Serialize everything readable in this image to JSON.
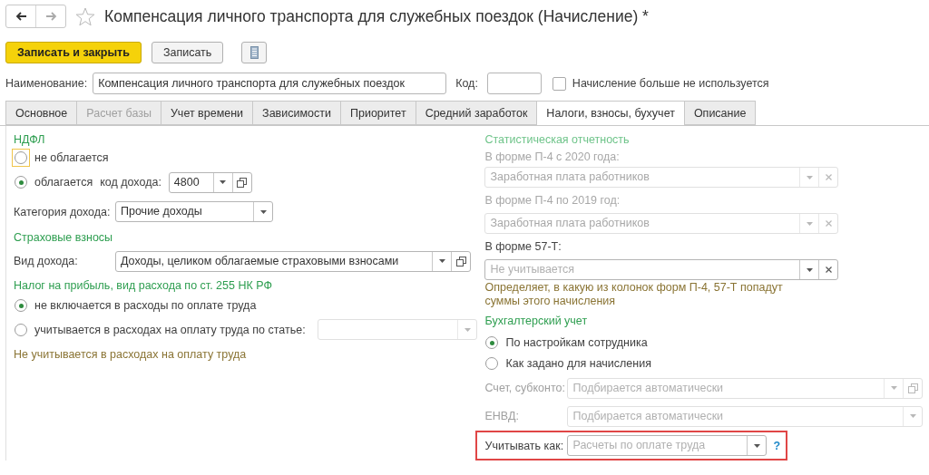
{
  "header": {
    "title": "Компенсация личного транспорта для служебных поездок (Начисление) *",
    "back_enabled": true,
    "forward_enabled": false,
    "favorite": false
  },
  "toolbar": {
    "buttons": [
      {
        "label": "Записать и закрыть",
        "kind": "primary"
      },
      {
        "label": "Записать",
        "kind": "normal"
      }
    ]
  },
  "name_row": {
    "label": "Наименование:",
    "value": "Компенсация личного транспорта для служебных поездок",
    "code_label": "Код:",
    "checkbox": {
      "label": "Начисление больше не используется",
      "checked": false
    }
  },
  "tabs": [
    {
      "label": "Основное",
      "selected": false,
      "disabled": false
    },
    {
      "label": "Расчет базы",
      "selected": false,
      "disabled": true
    },
    {
      "label": "Учет времени",
      "selected": false,
      "disabled": false
    },
    {
      "label": "Зависимости",
      "selected": false,
      "disabled": false
    },
    {
      "label": "Приоритет",
      "selected": false,
      "disabled": false
    },
    {
      "label": "Средний заработок",
      "selected": false,
      "disabled": false
    },
    {
      "label": "Налоги, взносы, бухучет",
      "selected": true,
      "disabled": false
    },
    {
      "label": "Описание",
      "selected": false,
      "disabled": false
    }
  ],
  "left": [
    {
      "kind": "heading",
      "text": "НДФЛ",
      "disabled": false
    },
    {
      "kind": "radio",
      "label": "не облагается",
      "selected": false,
      "focused": true
    },
    {
      "kind": "radio",
      "label": "облагается",
      "selected": true,
      "focused": false,
      "field": {
        "label": "код дохода:",
        "value": "4800",
        "dropdown": true,
        "open": true,
        "disabled": false
      }
    },
    {
      "kind": "field",
      "label": "Категория дохода:",
      "value": "Прочие доходы",
      "dropdown": true,
      "disabled": false
    },
    {
      "kind": "heading",
      "text": "Страховые взносы",
      "disabled": false
    },
    {
      "kind": "field",
      "label": "Вид дохода:",
      "value": "Доходы, целиком облагаемые страховыми взносами",
      "dropdown": true,
      "open": true,
      "disabled": false
    },
    {
      "kind": "heading",
      "text": "Налог на прибыль, вид расхода по ст. 255 НК РФ",
      "disabled": false
    },
    {
      "kind": "radio",
      "label": "не включается в расходы по оплате труда",
      "selected": true,
      "focused": false
    },
    {
      "kind": "radio",
      "label": "учитывается в расходах на оплату труда по статье:",
      "selected": false,
      "focused": false,
      "field": {
        "dropdown": true,
        "disabled": true
      }
    },
    {
      "kind": "note",
      "text": "Не учитывается в расходах на оплату труда"
    }
  ],
  "right": [
    {
      "kind": "heading",
      "text": "Статистическая отчетность",
      "disabled": true
    },
    {
      "kind": "caption",
      "text": "В форме П-4 с 2020 года:",
      "disabled": true
    },
    {
      "kind": "field",
      "value": "Заработная плата работников",
      "dropdown": true,
      "clear": true,
      "disabled": true
    },
    {
      "kind": "caption",
      "text": "В форме П-4 по 2019 год:",
      "disabled": true
    },
    {
      "kind": "field",
      "value": "Заработная плата работников",
      "dropdown": true,
      "clear": true,
      "disabled": true
    },
    {
      "kind": "caption",
      "text": "В форме 57-Т:",
      "disabled": false
    },
    {
      "kind": "field",
      "placeholder": "Не учитывается",
      "dropdown": true,
      "clear": true,
      "disabled": false
    },
    {
      "kind": "note",
      "text": "Определяет, в какую из колонок форм П-4, 57-Т попадут суммы этого начисления"
    },
    {
      "kind": "heading",
      "text": "Бухгалтерский учет",
      "disabled": false
    },
    {
      "kind": "radio",
      "label": "По настройкам сотрудника",
      "selected": true,
      "focused": false
    },
    {
      "kind": "radio",
      "label": "Как задано для начисления",
      "selected": false,
      "focused": false
    },
    {
      "kind": "field",
      "label": "Счет, субконто:",
      "placeholder": "Подбирается автоматически",
      "dropdown": true,
      "open": true,
      "disabled": true
    },
    {
      "kind": "field",
      "label": "ЕНВД:",
      "placeholder": "Подбирается автоматически",
      "dropdown": true,
      "disabled": true
    },
    {
      "kind": "field",
      "label": "Учитывать как:",
      "placeholder": "Расчеты по оплате труда",
      "dropdown": true,
      "disabled": false,
      "help": "?",
      "highlighted": true
    }
  ]
}
